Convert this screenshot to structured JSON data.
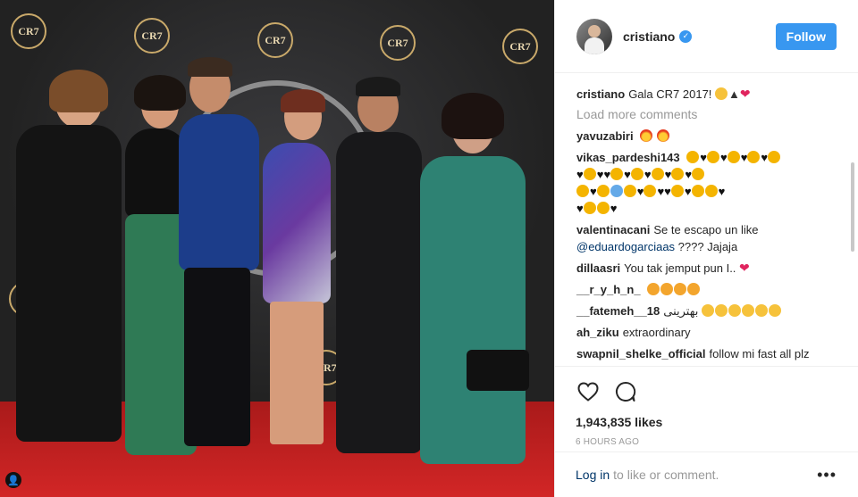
{
  "header": {
    "username": "cristiano",
    "follow_label": "Follow"
  },
  "photo": {
    "logo_text": "CR7"
  },
  "caption": {
    "author": "cristiano",
    "text": "Gala CR7 2017!"
  },
  "load_more": "Load more comments",
  "comments": [
    {
      "author": "yavuzabiri",
      "text": ""
    },
    {
      "author": "vikas_pardeshi143",
      "text": ""
    },
    {
      "author": "valentinacani",
      "text": "Se te escapo un like",
      "mention": "@eduardogarciaas",
      "tail": "???? Jajaja"
    },
    {
      "author": "dillaasri",
      "text": "You tak jemput pun I.."
    },
    {
      "author": "__r_y_h_n_",
      "text": ""
    },
    {
      "author": "__fatemeh__18",
      "text": "بهترینی"
    },
    {
      "author": "ah_ziku",
      "text": "extraordinary"
    },
    {
      "author": "swapnil_shelke_official",
      "text": "follow mi fast all plz"
    }
  ],
  "likes": "1,943,835 likes",
  "time": "6 HOURS AGO",
  "footer": {
    "login": "Log in",
    "rest": "to like or comment.",
    "more": "•••"
  },
  "icons": {
    "like": "heart-icon",
    "comment": "comment-icon",
    "verified": "verified-badge-icon",
    "more": "more-options-icon"
  },
  "colors": {
    "accent": "#3897f0",
    "link": "#003569",
    "muted": "#999999"
  }
}
